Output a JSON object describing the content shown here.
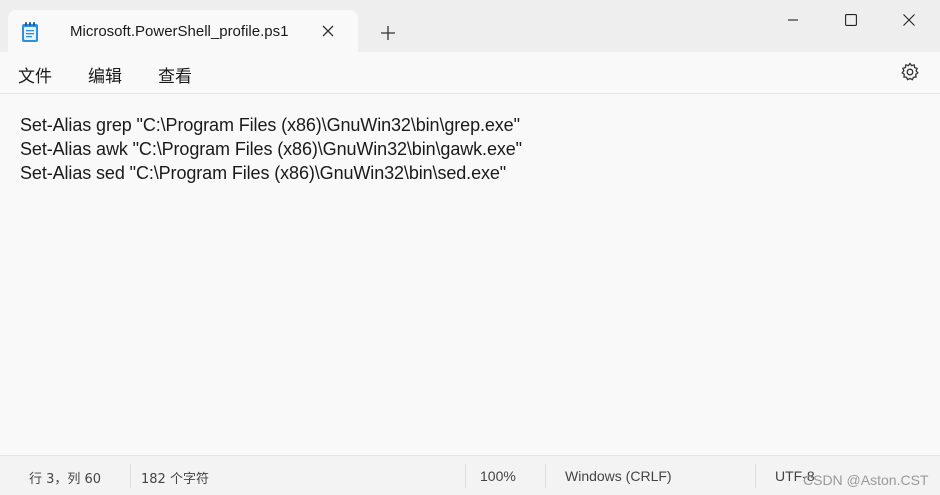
{
  "tab": {
    "title": "Microsoft.PowerShell_profile.ps1"
  },
  "menu": {
    "file": "文件",
    "edit": "编辑",
    "view": "查看"
  },
  "editor": {
    "lines": [
      "Set-Alias grep \"C:\\Program Files (x86)\\GnuWin32\\bin\\grep.exe\"",
      "Set-Alias awk \"C:\\Program Files (x86)\\GnuWin32\\bin\\gawk.exe\"",
      "Set-Alias sed \"C:\\Program Files (x86)\\GnuWin32\\bin\\sed.exe\""
    ]
  },
  "status": {
    "position": "行 3，列 60",
    "char_count": "182 个字符",
    "zoom": "100%",
    "line_ending": "Windows (CRLF)",
    "encoding": "UTF-8"
  },
  "watermark": "CSDN @Aston.CST",
  "icons": {
    "app": "notepad-icon",
    "tab_close": "close-icon",
    "new_tab": "plus-icon",
    "minimize": "minimize-icon",
    "maximize": "maximize-icon",
    "close": "close-icon",
    "settings": "gear-icon"
  },
  "colors": {
    "titlebar_bg": "#eeeeee",
    "editor_bg": "#f9f9f9",
    "statusbar_bg": "#f3f3f3",
    "icon_blue": "#2f8fd8",
    "text": "#1a1a1a"
  }
}
